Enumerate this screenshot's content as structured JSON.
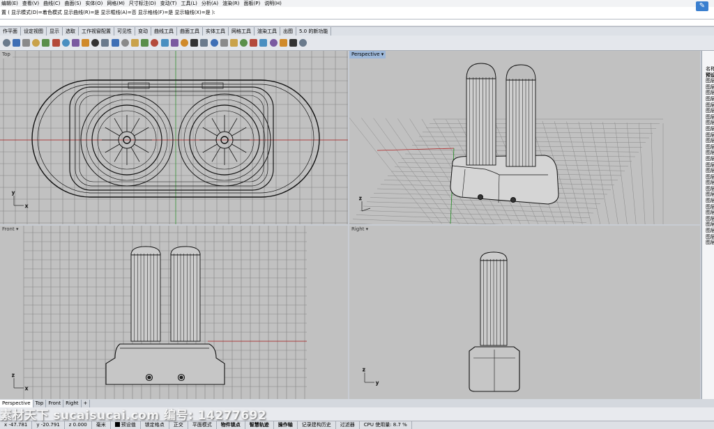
{
  "menus": [
    "编辑(E)",
    "查看(V)",
    "曲线(C)",
    "曲面(S)",
    "实体(O)",
    "网格(M)",
    "尺寸标注(D)",
    "变动(T)",
    "工具(L)",
    "分析(A)",
    "渲染(R)",
    "面板(P)",
    "说明(H)"
  ],
  "command_history": "置 ( 显示模式(D)=着色模式  显示曲线(R)=是  显示框线(A)=否  显示格线(F)=是  显示轴线(X)=是 ):",
  "toolbar_tabs": [
    "作平面",
    "设定视图",
    "显示",
    "选取",
    "工作视窗配置",
    "可见性",
    "变动",
    "曲线工具",
    "曲面工具",
    "实体工具",
    "网格工具",
    "渲染工具",
    "出图",
    "5.0 的新功能"
  ],
  "toolbar_icons": [
    "open-icon",
    "save-icon",
    "print-icon",
    "import-icon",
    "cut-icon",
    "copy-icon",
    "paste-icon",
    "undo-icon",
    "pan-icon",
    "move-view-icon",
    "zoom-icon",
    "zoom-window-icon",
    "zoom-extents-icon",
    "zoom-selected-icon",
    "rotate-icon",
    "four-view-icon",
    "plane-icon",
    "layer-icon",
    "properties-icon",
    "grid-icon",
    "point-icon",
    "lamp-icon",
    "lock-icon",
    "material-icon",
    "render-icon",
    "shaded-icon",
    "sphere-icon",
    "globe-icon",
    "gear-icon",
    "tools-icon",
    "help-icon"
  ],
  "viewports": {
    "top": "Top",
    "perspective": "Perspective",
    "front": "Front",
    "right": "Right"
  },
  "axes": {
    "x": "x",
    "y": "y",
    "z": "z"
  },
  "layers_panel": {
    "header": "名称",
    "default_layer": "预设",
    "items": [
      "图层",
      "图层",
      "图层",
      "图层",
      "图层",
      "图层",
      "图层",
      "图层",
      "图层",
      "图层",
      "图层",
      "图层",
      "图层",
      "图层",
      "图层",
      "图层",
      "图层",
      "图层",
      "图层",
      "图层",
      "图层",
      "图层",
      "图层",
      "图层",
      "图层",
      "图层",
      "图层",
      "图层"
    ]
  },
  "viewport_tabs": [
    "Perspective",
    "Top",
    "Front",
    "Right"
  ],
  "watermark": "素材天下 sucaisucai.com  编号: 14277692",
  "status": {
    "x": "x -47.781",
    "y": "y -20.791",
    "z": "z 0.000",
    "units": "毫米",
    "layer": "预设值",
    "toggles": [
      "锁定格点",
      "正交",
      "平面模式",
      "物件锁点",
      "智慧轨迹",
      "操作轴",
      "记录建构历史",
      "过滤器"
    ],
    "cpu": "CPU 使用量: 8.7 %"
  },
  "colors": {
    "viewport_bg": "#c1c1c1",
    "grid": "#7e7e7e",
    "x_axis": "#b02020",
    "y_axis": "#1f8a1f",
    "active_label": "#9db7d8"
  }
}
